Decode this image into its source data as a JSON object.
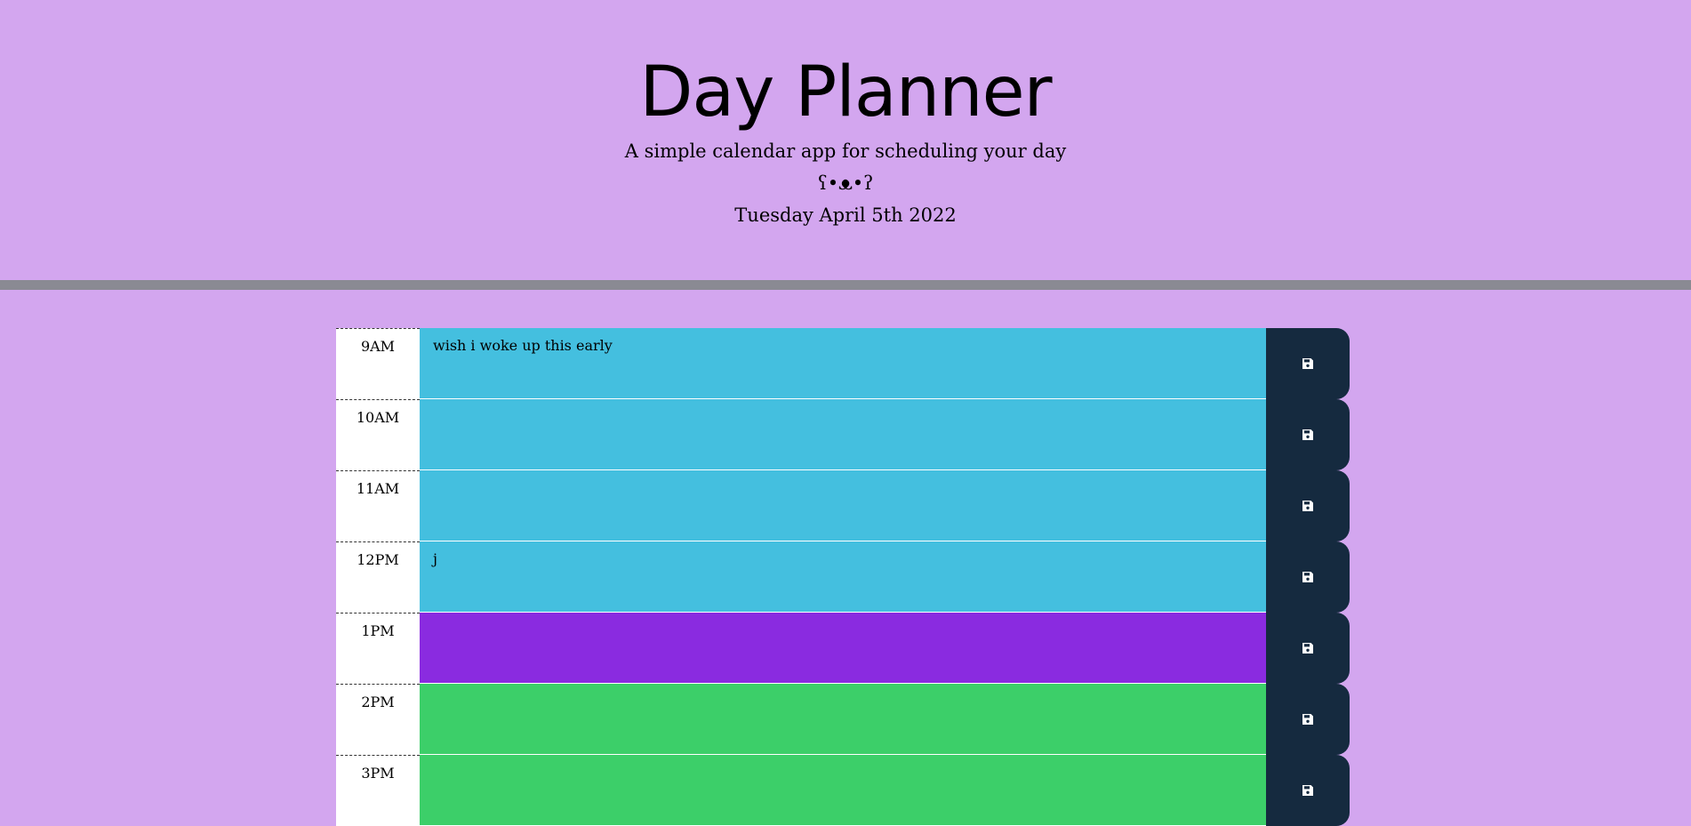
{
  "header": {
    "title": "Day Planner",
    "subtitle": "A simple calendar app for scheduling your day",
    "emoticon": "ʕ•ᴥ•ʔ",
    "current_date": "Tuesday April 5th 2022"
  },
  "colors": {
    "background": "#d3a6ef",
    "past": "#44bfdf",
    "present": "#8a2be0",
    "future": "#3ccf69",
    "save_button": "#152a3f"
  },
  "save_icon": "floppy-disk-icon",
  "time_blocks": [
    {
      "hour": "9AM",
      "text": "wish i woke up this early",
      "state": "past"
    },
    {
      "hour": "10AM",
      "text": "",
      "state": "past"
    },
    {
      "hour": "11AM",
      "text": "",
      "state": "past"
    },
    {
      "hour": "12PM",
      "text": "j",
      "state": "past"
    },
    {
      "hour": "1PM",
      "text": "",
      "state": "present"
    },
    {
      "hour": "2PM",
      "text": "",
      "state": "future"
    },
    {
      "hour": "3PM",
      "text": "",
      "state": "future"
    }
  ]
}
